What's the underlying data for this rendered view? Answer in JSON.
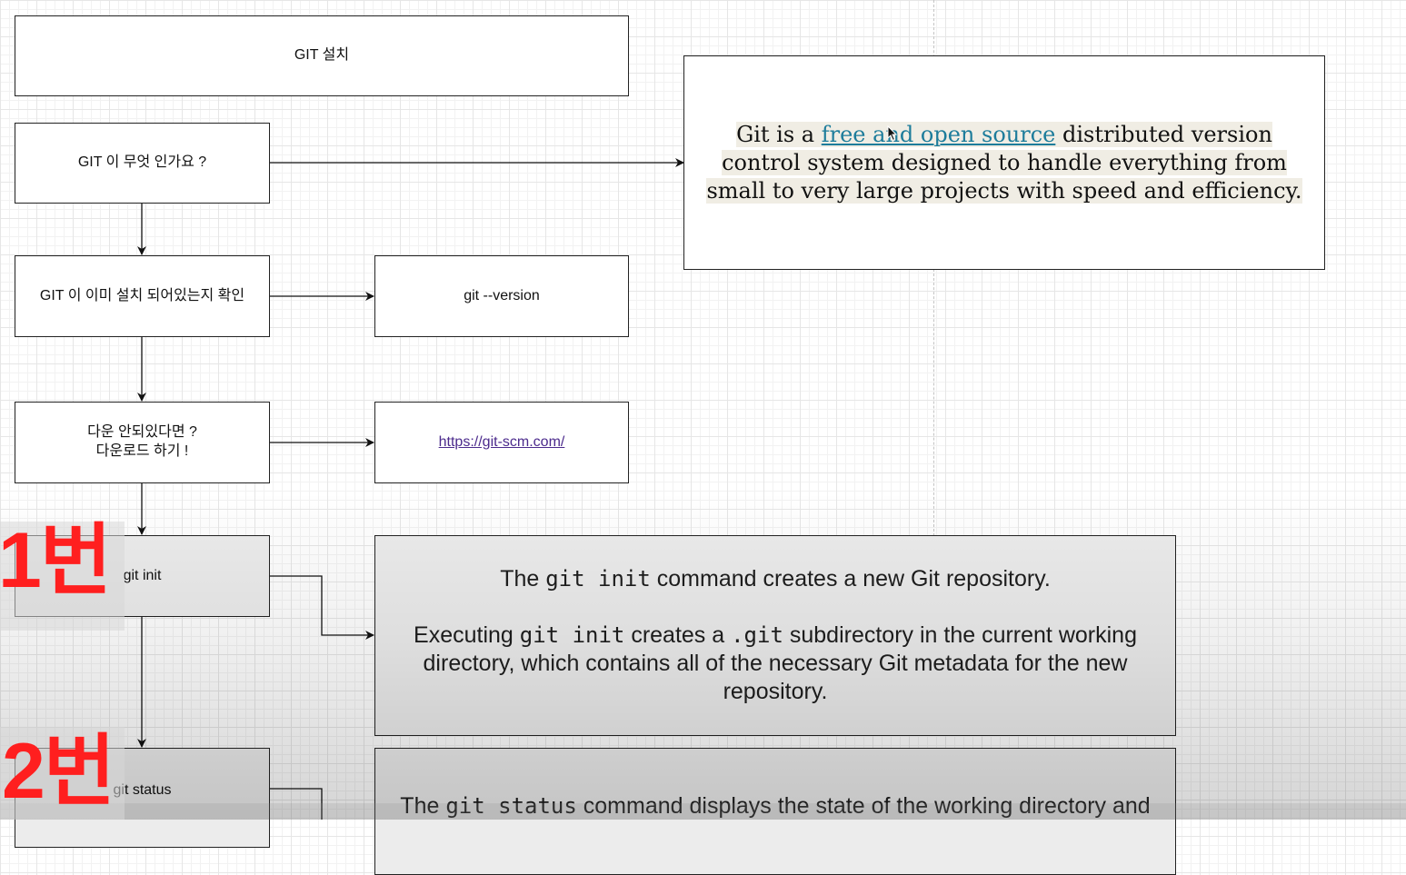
{
  "nodes": {
    "title": "GIT 설치",
    "what_is_git": "GIT 이 무엇 인가요 ?",
    "check_installed": "GIT 이 이미 설치 되어있는지 확인",
    "version_cmd": "git --version",
    "not_installed": "다운 안되있다면 ?\n다운로드 하기 !",
    "download_url": "https://git-scm.com/",
    "git_init": "git init",
    "git_status": "git status"
  },
  "git_description": {
    "prefix": "Git is a ",
    "link": "free and open source",
    "suffix": " distributed version control system designed to handle everything from small to very large projects with speed and efficiency."
  },
  "init_info": {
    "line1_a": "The ",
    "line1_code": "git init",
    "line1_b": " command creates a new Git repository.",
    "line2_a": "Executing ",
    "line2_code1": "git init",
    "line2_b": " creates a ",
    "line2_code2": ".git",
    "line2_c": " subdirectory in the current working directory, which contains all of the necessary Git metadata for the new repository."
  },
  "status_info": {
    "line1_a": "The ",
    "line1_code": "git status",
    "line1_b": " command displays the state of the working directory and"
  },
  "badges": {
    "step1": "1번",
    "step2": "2번"
  }
}
